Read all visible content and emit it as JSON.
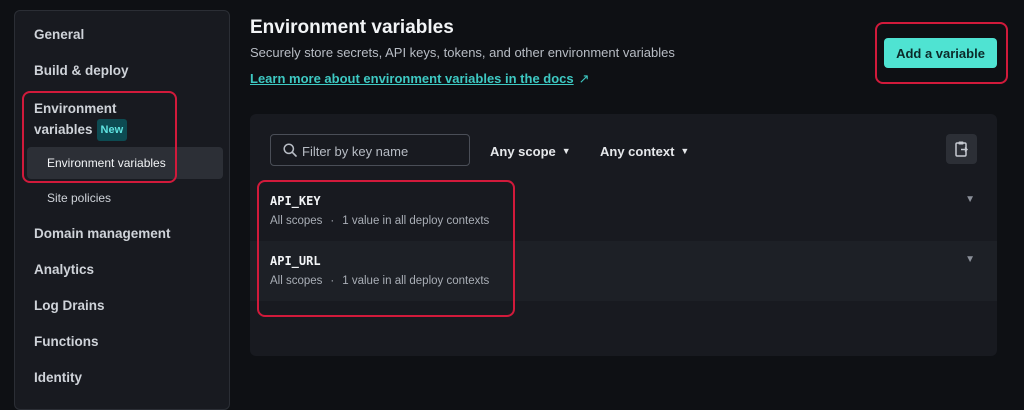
{
  "sidebar": {
    "items": [
      {
        "label": "General"
      },
      {
        "label": "Build & deploy"
      },
      {
        "label_line1": "Environment",
        "label_line2": "variables",
        "badge": "New"
      },
      {
        "label": "Environment variables"
      },
      {
        "label": "Site policies"
      },
      {
        "label": "Domain management"
      },
      {
        "label": "Analytics"
      },
      {
        "label": "Log Drains"
      },
      {
        "label": "Functions"
      },
      {
        "label": "Identity"
      }
    ]
  },
  "header": {
    "title": "Environment variables",
    "subtitle": "Securely store secrets, API keys, tokens, and other environment variables",
    "docs_link": "Learn more about environment variables in the docs",
    "docs_link_icon": "↗",
    "add_button": "Add a variable"
  },
  "toolbar": {
    "filter_placeholder": "Filter by key name",
    "scope_dropdown": "Any scope",
    "context_dropdown": "Any context",
    "chevron": "▼"
  },
  "variables": [
    {
      "key": "API_KEY",
      "scopes": "All scopes",
      "separator": "·",
      "contexts": "1 value in all deploy contexts"
    },
    {
      "key": "API_URL",
      "scopes": "All scopes",
      "separator": "·",
      "contexts": "1 value in all deploy contexts"
    }
  ],
  "icons": {
    "row_expand": "▼"
  },
  "colors": {
    "accent": "#4fe3d2",
    "link": "#3ec9c3",
    "highlight": "#d11a3b",
    "background": "#0e1014",
    "panel": "#181a20"
  }
}
